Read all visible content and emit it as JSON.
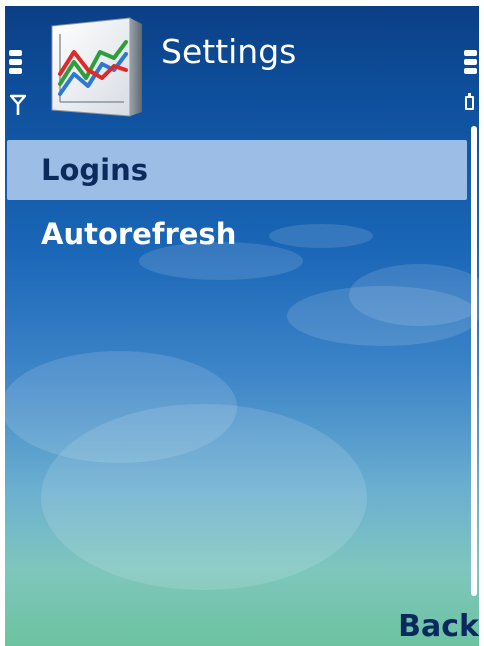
{
  "header": {
    "title": "Settings",
    "app_icon": "chart-lines-icon"
  },
  "status": {
    "signal_icon": "signal-antenna-icon",
    "battery_icon": "battery-icon"
  },
  "menu": {
    "items": [
      {
        "label": "Logins",
        "selected": true
      },
      {
        "label": "Autorefresh",
        "selected": false
      }
    ]
  },
  "softkeys": {
    "right": "Back"
  },
  "colors": {
    "selection_bg": "#9cbde6",
    "selected_text": "#0c2a5c",
    "softkey_text": "#0a2a5e"
  }
}
